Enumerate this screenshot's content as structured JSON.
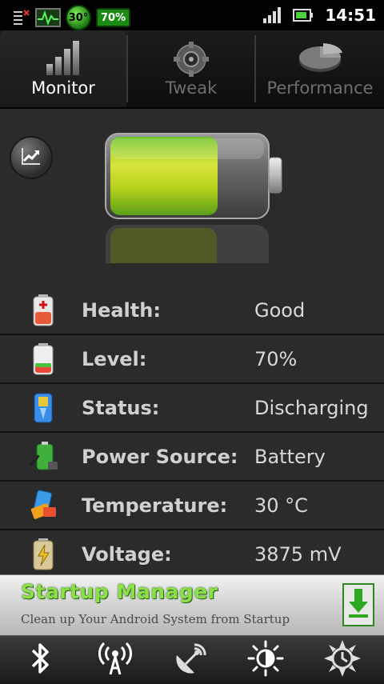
{
  "status_bar": {
    "time": "14:51",
    "temp_badge": "30°",
    "battery_badge": "70%",
    "icons": [
      "notification-icon",
      "pulse-monitor-icon",
      "signal-icon",
      "battery-icon"
    ]
  },
  "tabs": [
    {
      "label": "Monitor",
      "icon": "signal-bars-icon",
      "active": true
    },
    {
      "label": "Tweak",
      "icon": "gear-icon",
      "active": false
    },
    {
      "label": "Performance",
      "icon": "pie-chart-icon",
      "active": false
    }
  ],
  "battery": {
    "level_fraction": 0.7
  },
  "info_rows": [
    {
      "label": "Health:",
      "value": "Good",
      "icon": "battery-health-icon"
    },
    {
      "label": "Level:",
      "value": "70%",
      "icon": "battery-level-icon"
    },
    {
      "label": "Status:",
      "value": "Discharging",
      "icon": "battery-status-icon"
    },
    {
      "label": "Power Source:",
      "value": "Battery",
      "icon": "power-source-icon"
    },
    {
      "label": "Temperature:",
      "value": "30 °C",
      "icon": "temperature-icon"
    },
    {
      "label": "Voltage:",
      "value": "3875 mV",
      "icon": "voltage-icon"
    }
  ],
  "ad": {
    "title": "Startup Manager",
    "subtitle": "Clean up Your Android System from Startup"
  },
  "toggles": [
    "bluetooth-icon",
    "wifi-icon",
    "gps-icon",
    "brightness-icon",
    "timeout-icon"
  ],
  "colors": {
    "accent_green": "#8be04a",
    "battery_fill": "#b9d61c"
  }
}
